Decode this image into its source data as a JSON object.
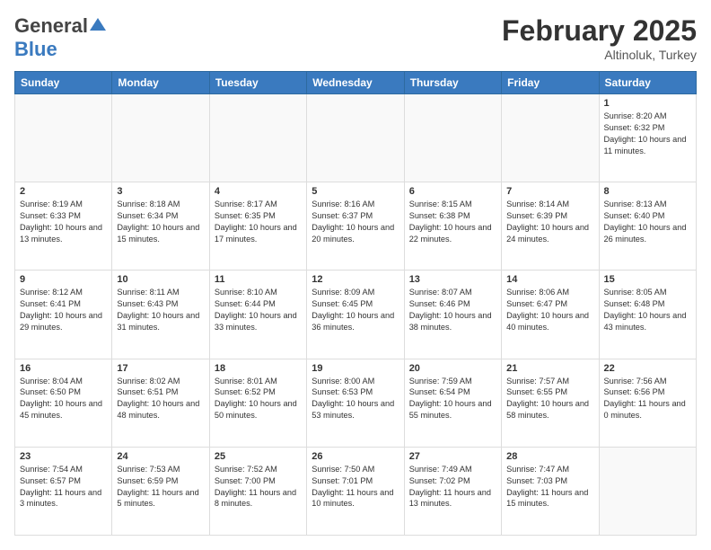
{
  "header": {
    "logo_general": "General",
    "logo_blue": "Blue",
    "title": "February 2025",
    "location": "Altinoluk, Turkey"
  },
  "weekdays": [
    "Sunday",
    "Monday",
    "Tuesday",
    "Wednesday",
    "Thursday",
    "Friday",
    "Saturday"
  ],
  "weeks": [
    [
      null,
      null,
      null,
      null,
      null,
      null,
      {
        "day": "1",
        "sunrise": "Sunrise: 8:20 AM",
        "sunset": "Sunset: 6:32 PM",
        "daylight": "Daylight: 10 hours and 11 minutes."
      }
    ],
    [
      {
        "day": "2",
        "sunrise": "Sunrise: 8:19 AM",
        "sunset": "Sunset: 6:33 PM",
        "daylight": "Daylight: 10 hours and 13 minutes."
      },
      {
        "day": "3",
        "sunrise": "Sunrise: 8:18 AM",
        "sunset": "Sunset: 6:34 PM",
        "daylight": "Daylight: 10 hours and 15 minutes."
      },
      {
        "day": "4",
        "sunrise": "Sunrise: 8:17 AM",
        "sunset": "Sunset: 6:35 PM",
        "daylight": "Daylight: 10 hours and 17 minutes."
      },
      {
        "day": "5",
        "sunrise": "Sunrise: 8:16 AM",
        "sunset": "Sunset: 6:37 PM",
        "daylight": "Daylight: 10 hours and 20 minutes."
      },
      {
        "day": "6",
        "sunrise": "Sunrise: 8:15 AM",
        "sunset": "Sunset: 6:38 PM",
        "daylight": "Daylight: 10 hours and 22 minutes."
      },
      {
        "day": "7",
        "sunrise": "Sunrise: 8:14 AM",
        "sunset": "Sunset: 6:39 PM",
        "daylight": "Daylight: 10 hours and 24 minutes."
      },
      {
        "day": "8",
        "sunrise": "Sunrise: 8:13 AM",
        "sunset": "Sunset: 6:40 PM",
        "daylight": "Daylight: 10 hours and 26 minutes."
      }
    ],
    [
      {
        "day": "9",
        "sunrise": "Sunrise: 8:12 AM",
        "sunset": "Sunset: 6:41 PM",
        "daylight": "Daylight: 10 hours and 29 minutes."
      },
      {
        "day": "10",
        "sunrise": "Sunrise: 8:11 AM",
        "sunset": "Sunset: 6:43 PM",
        "daylight": "Daylight: 10 hours and 31 minutes."
      },
      {
        "day": "11",
        "sunrise": "Sunrise: 8:10 AM",
        "sunset": "Sunset: 6:44 PM",
        "daylight": "Daylight: 10 hours and 33 minutes."
      },
      {
        "day": "12",
        "sunrise": "Sunrise: 8:09 AM",
        "sunset": "Sunset: 6:45 PM",
        "daylight": "Daylight: 10 hours and 36 minutes."
      },
      {
        "day": "13",
        "sunrise": "Sunrise: 8:07 AM",
        "sunset": "Sunset: 6:46 PM",
        "daylight": "Daylight: 10 hours and 38 minutes."
      },
      {
        "day": "14",
        "sunrise": "Sunrise: 8:06 AM",
        "sunset": "Sunset: 6:47 PM",
        "daylight": "Daylight: 10 hours and 40 minutes."
      },
      {
        "day": "15",
        "sunrise": "Sunrise: 8:05 AM",
        "sunset": "Sunset: 6:48 PM",
        "daylight": "Daylight: 10 hours and 43 minutes."
      }
    ],
    [
      {
        "day": "16",
        "sunrise": "Sunrise: 8:04 AM",
        "sunset": "Sunset: 6:50 PM",
        "daylight": "Daylight: 10 hours and 45 minutes."
      },
      {
        "day": "17",
        "sunrise": "Sunrise: 8:02 AM",
        "sunset": "Sunset: 6:51 PM",
        "daylight": "Daylight: 10 hours and 48 minutes."
      },
      {
        "day": "18",
        "sunrise": "Sunrise: 8:01 AM",
        "sunset": "Sunset: 6:52 PM",
        "daylight": "Daylight: 10 hours and 50 minutes."
      },
      {
        "day": "19",
        "sunrise": "Sunrise: 8:00 AM",
        "sunset": "Sunset: 6:53 PM",
        "daylight": "Daylight: 10 hours and 53 minutes."
      },
      {
        "day": "20",
        "sunrise": "Sunrise: 7:59 AM",
        "sunset": "Sunset: 6:54 PM",
        "daylight": "Daylight: 10 hours and 55 minutes."
      },
      {
        "day": "21",
        "sunrise": "Sunrise: 7:57 AM",
        "sunset": "Sunset: 6:55 PM",
        "daylight": "Daylight: 10 hours and 58 minutes."
      },
      {
        "day": "22",
        "sunrise": "Sunrise: 7:56 AM",
        "sunset": "Sunset: 6:56 PM",
        "daylight": "Daylight: 11 hours and 0 minutes."
      }
    ],
    [
      {
        "day": "23",
        "sunrise": "Sunrise: 7:54 AM",
        "sunset": "Sunset: 6:57 PM",
        "daylight": "Daylight: 11 hours and 3 minutes."
      },
      {
        "day": "24",
        "sunrise": "Sunrise: 7:53 AM",
        "sunset": "Sunset: 6:59 PM",
        "daylight": "Daylight: 11 hours and 5 minutes."
      },
      {
        "day": "25",
        "sunrise": "Sunrise: 7:52 AM",
        "sunset": "Sunset: 7:00 PM",
        "daylight": "Daylight: 11 hours and 8 minutes."
      },
      {
        "day": "26",
        "sunrise": "Sunrise: 7:50 AM",
        "sunset": "Sunset: 7:01 PM",
        "daylight": "Daylight: 11 hours and 10 minutes."
      },
      {
        "day": "27",
        "sunrise": "Sunrise: 7:49 AM",
        "sunset": "Sunset: 7:02 PM",
        "daylight": "Daylight: 11 hours and 13 minutes."
      },
      {
        "day": "28",
        "sunrise": "Sunrise: 7:47 AM",
        "sunset": "Sunset: 7:03 PM",
        "daylight": "Daylight: 11 hours and 15 minutes."
      },
      null
    ]
  ]
}
